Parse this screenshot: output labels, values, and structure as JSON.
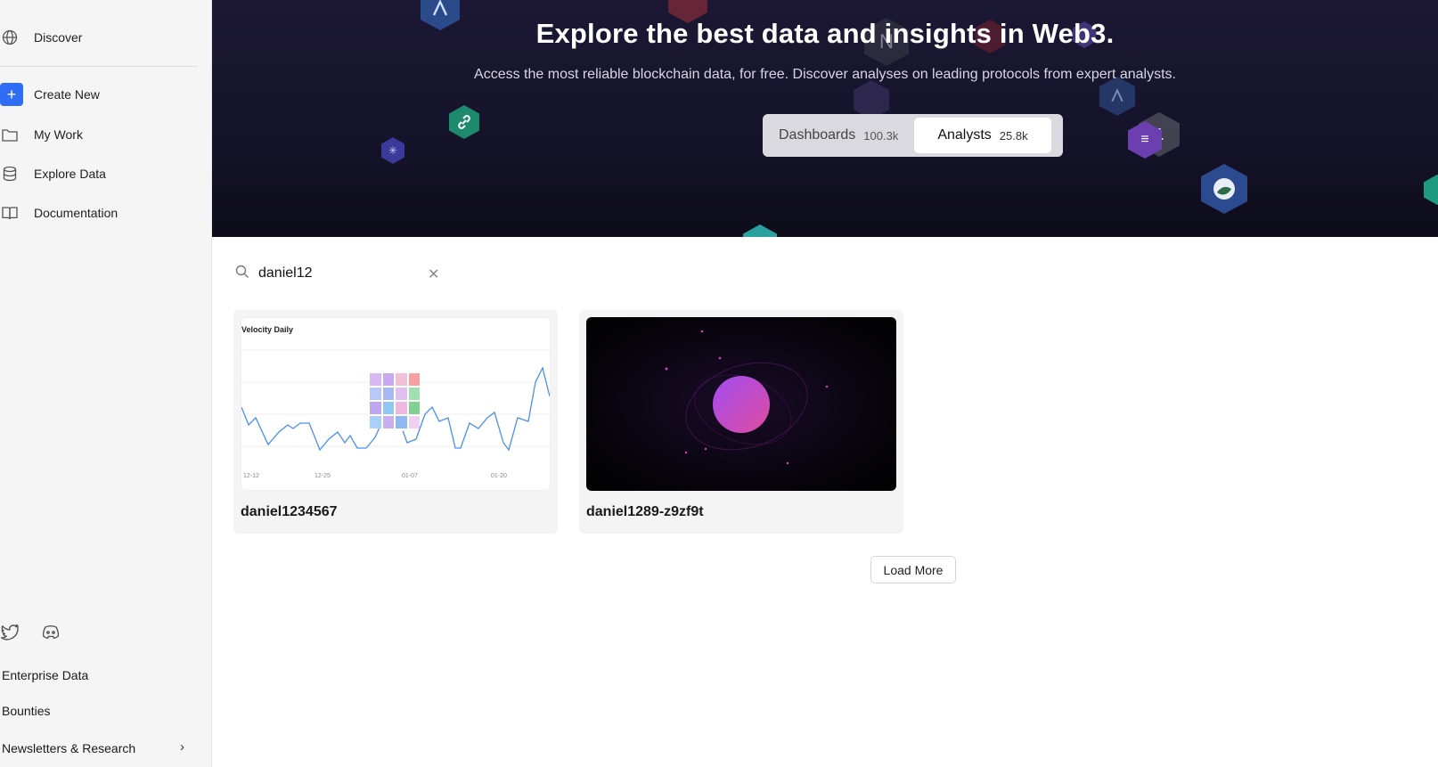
{
  "sidebar": {
    "items": [
      {
        "label": "Discover",
        "icon": "globe-icon"
      },
      {
        "label": "Create New",
        "icon": "plus-icon"
      },
      {
        "label": "My Work",
        "icon": "folder-icon"
      },
      {
        "label": "Explore Data",
        "icon": "database-icon"
      },
      {
        "label": "Documentation",
        "icon": "book-icon"
      }
    ],
    "social_icons": [
      "twitter-icon",
      "discord-icon"
    ],
    "footer_links": [
      {
        "label": "Enterprise Data"
      },
      {
        "label": "Bounties"
      },
      {
        "label": "Newsletters & Research"
      }
    ]
  },
  "hero": {
    "title": "Explore the best data and insights in Web3.",
    "subtitle": "Access the most reliable blockchain data, for free. Discover analyses on leading protocols from expert analysts.",
    "tabs": [
      {
        "label": "Dashboards",
        "count": "100.3k",
        "active": false
      },
      {
        "label": "Analysts",
        "count": "25.8k",
        "active": true
      }
    ]
  },
  "search": {
    "value": "daniel12"
  },
  "results": [
    {
      "name": "daniel1234567",
      "thumb_title": "Velocity Daily",
      "thumb_ticks": [
        "12-12",
        "12-25",
        "01-07",
        "01-20"
      ]
    },
    {
      "name": "daniel1289-z9zf9t"
    }
  ],
  "load_more_label": "Load More",
  "colors": {
    "accent": "#2f6df6",
    "hero_bg": "#15132a"
  }
}
